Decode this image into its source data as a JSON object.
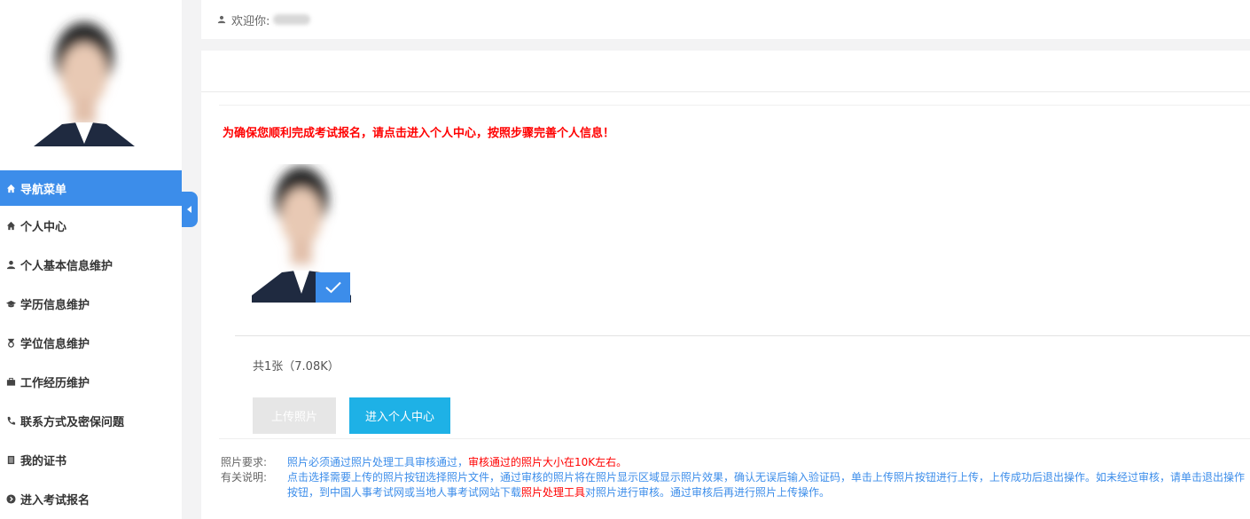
{
  "topbar": {
    "welcome": "欢迎你:"
  },
  "sidebar": {
    "items": [
      {
        "label": "导航菜单",
        "icon": "home-icon"
      },
      {
        "label": "个人中心",
        "icon": "home-icon"
      },
      {
        "label": "个人基本信息维护",
        "icon": "user-icon"
      },
      {
        "label": "学历信息维护",
        "icon": "graduation-cap-icon"
      },
      {
        "label": "学位信息维护",
        "icon": "medal-icon"
      },
      {
        "label": "工作经历维护",
        "icon": "briefcase-icon"
      },
      {
        "label": "联系方式及密保问题",
        "icon": "phone-icon"
      },
      {
        "label": "我的证书",
        "icon": "certificate-icon"
      },
      {
        "label": "进入考试报名",
        "icon": "circle-arrow-icon"
      }
    ]
  },
  "main": {
    "notice": "为确保您顺利完成考试报名，请点击进入个人中心，按照步骤完善个人信息！",
    "count": "共1张（7.08K）",
    "upload_label": "上传照片",
    "enter_label": "进入个人中心",
    "req_label": "照片要求:",
    "req_text": "照片必须通过照片处理工具审核通过，",
    "req_red": "审核通过的照片大小在10K左右。",
    "note_label": "有关说明:",
    "note_text1": "点击选择需要上传的照片按钮选择照片文件，通过审核的照片将在照片显示区域显示照片效果，确认无误后输入验证码，单击上传照片按钮进行上传，上传成功后退出操作。如未经过审核，请单击退出操作按钮，到中国人事考试网或当地人事考试网站下载",
    "note_red": "照片处理工具",
    "note_text2": "对照片进行审核。通过审核后再进行照片上传操作。"
  },
  "colors": {
    "accent": "#3c8dea",
    "button": "#1eb1e6",
    "warning": "#ff0000"
  }
}
